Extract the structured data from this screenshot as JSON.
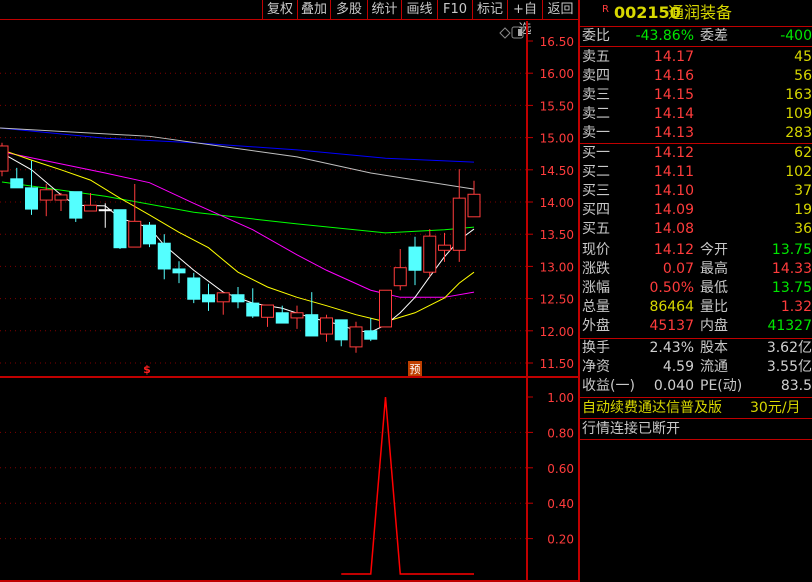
{
  "toolbar": {
    "buttons": [
      "复权",
      "叠加",
      "多股",
      "统计",
      "画线",
      "F10",
      "标记",
      "+自选",
      "返回"
    ]
  },
  "stock": {
    "flag": "R",
    "code": "002150",
    "name": "通润装备"
  },
  "committee": {
    "ratio_label": "委比",
    "ratio": "-43.86%",
    "diff_label": "委差",
    "diff": "-400"
  },
  "sell": [
    {
      "label": "卖五",
      "price": "14.17",
      "vol": "45"
    },
    {
      "label": "卖四",
      "price": "14.16",
      "vol": "56"
    },
    {
      "label": "卖三",
      "price": "14.15",
      "vol": "163"
    },
    {
      "label": "卖二",
      "price": "14.14",
      "vol": "109"
    },
    {
      "label": "卖一",
      "price": "14.13",
      "vol": "283"
    }
  ],
  "buy": [
    {
      "label": "买一",
      "price": "14.12",
      "vol": "62"
    },
    {
      "label": "买二",
      "price": "14.11",
      "vol": "102"
    },
    {
      "label": "买三",
      "price": "14.10",
      "vol": "37"
    },
    {
      "label": "买四",
      "price": "14.09",
      "vol": "19"
    },
    {
      "label": "买五",
      "price": "14.08",
      "vol": "36"
    }
  ],
  "quote": [
    {
      "l1": "现价",
      "v1": "14.12",
      "c1": "red",
      "l2": "今开",
      "v2": "13.75",
      "c2": "grn"
    },
    {
      "l1": "涨跌",
      "v1": "0.07",
      "c1": "red",
      "l2": "最高",
      "v2": "14.33",
      "c2": "red"
    },
    {
      "l1": "涨幅",
      "v1": "0.50%",
      "c1": "red",
      "l2": "最低",
      "v2": "13.75",
      "c2": "grn"
    },
    {
      "l1": "总量",
      "v1": "86464",
      "c1": "yel",
      "l2": "量比",
      "v2": "1.32",
      "c2": "red"
    },
    {
      "l1": "外盘",
      "v1": "45137",
      "c1": "red",
      "l2": "内盘",
      "v2": "41327",
      "c2": "grn"
    }
  ],
  "finance": [
    {
      "l1": "换手",
      "v1": "2.43%",
      "l2": "股本",
      "v2": "3.62亿"
    },
    {
      "l1": "净资",
      "v1": "4.59",
      "l2": "流通",
      "v2": "3.55亿"
    },
    {
      "l1": "收益(一)",
      "v1": "0.040",
      "l2": "PE(动)",
      "v2": "83.5"
    }
  ],
  "ad": {
    "text": "自动续费通达信普及版",
    "price": "30元/月"
  },
  "status": "行情连接已断开",
  "markers": {
    "s": "$",
    "yu": "预"
  },
  "colors": {
    "up": "#ff3c3c",
    "down": "#54ffff",
    "ma5": "#ffffff",
    "ma10": "#ffff00",
    "ma20": "#ff00ff",
    "ma30": "#00ff00",
    "ma60": "#c0c0c0",
    "ma120": "#0000ff",
    "grid": "#800000"
  },
  "chart_data": [
    {
      "type": "candlestick",
      "yticks": [
        "16.50",
        "16.00",
        "15.50",
        "15.00",
        "14.50",
        "14.00",
        "13.50",
        "13.00",
        "12.50",
        "12.00",
        "11.50"
      ],
      "ylim": [
        11.5,
        16.5
      ],
      "ohlc": [
        [
          14.48,
          14.92,
          14.4,
          14.87
        ],
        [
          14.36,
          14.53,
          14.22,
          14.22
        ],
        [
          14.22,
          14.64,
          13.8,
          13.89
        ],
        [
          14.03,
          14.28,
          13.78,
          14.19
        ],
        [
          14.03,
          14.14,
          13.86,
          14.11
        ],
        [
          14.16,
          14.16,
          13.69,
          13.75
        ],
        [
          13.86,
          14.14,
          13.86,
          13.95
        ],
        [
          13.88,
          13.98,
          13.6,
          13.88
        ],
        [
          13.88,
          13.88,
          13.27,
          13.29
        ],
        [
          13.3,
          14.28,
          13.3,
          13.7
        ],
        [
          13.64,
          13.69,
          13.3,
          13.35
        ],
        [
          13.36,
          13.5,
          12.8,
          12.96
        ],
        [
          12.96,
          13.08,
          12.74,
          12.9
        ],
        [
          12.82,
          12.9,
          12.43,
          12.49
        ],
        [
          12.56,
          12.73,
          12.31,
          12.45
        ],
        [
          12.45,
          12.59,
          12.25,
          12.59
        ],
        [
          12.56,
          12.68,
          12.35,
          12.45
        ],
        [
          12.43,
          12.66,
          12.2,
          12.23
        ],
        [
          12.21,
          12.39,
          12.06,
          12.4
        ],
        [
          12.28,
          12.39,
          12.12,
          12.12
        ],
        [
          12.2,
          12.39,
          12.03,
          12.28
        ],
        [
          12.25,
          12.6,
          11.92,
          11.92
        ],
        [
          11.95,
          12.25,
          11.83,
          12.2
        ],
        [
          12.17,
          12.17,
          11.76,
          11.86
        ],
        [
          11.75,
          12.14,
          11.66,
          12.06
        ],
        [
          12.0,
          12.2,
          11.84,
          11.87
        ],
        [
          12.06,
          12.63,
          12.06,
          12.63
        ],
        [
          12.7,
          13.27,
          12.63,
          12.98
        ],
        [
          13.3,
          13.46,
          12.71,
          12.94
        ],
        [
          12.91,
          13.58,
          12.84,
          13.47
        ],
        [
          13.25,
          13.52,
          13.07,
          13.33
        ],
        [
          13.25,
          14.51,
          13.07,
          14.06
        ],
        [
          13.77,
          14.33,
          13.77,
          14.12
        ]
      ],
      "ma": {
        "ma5": [
          [
            0,
            14.76
          ],
          [
            2,
            14.5
          ],
          [
            4,
            14.11
          ],
          [
            5,
            13.95
          ],
          [
            7,
            13.94
          ],
          [
            8,
            13.75
          ],
          [
            10,
            13.6
          ],
          [
            11,
            13.33
          ],
          [
            13,
            12.94
          ],
          [
            15,
            12.6
          ],
          [
            17,
            12.43
          ],
          [
            19,
            12.35
          ],
          [
            21,
            12.2
          ],
          [
            23,
            12.09
          ],
          [
            24,
            12.0
          ],
          [
            25,
            11.98
          ],
          [
            26,
            12.09
          ],
          [
            27,
            12.28
          ],
          [
            28,
            12.52
          ],
          [
            29,
            12.84
          ],
          [
            30,
            13.15
          ],
          [
            31,
            13.41
          ],
          [
            32,
            13.58
          ]
        ],
        "ma10": [
          [
            0,
            14.81
          ],
          [
            2,
            14.65
          ],
          [
            4,
            14.5
          ],
          [
            6,
            14.34
          ],
          [
            8,
            14.06
          ],
          [
            10,
            13.8
          ],
          [
            12,
            13.53
          ],
          [
            14,
            13.29
          ],
          [
            16,
            12.91
          ],
          [
            18,
            12.68
          ],
          [
            20,
            12.52
          ],
          [
            22,
            12.39
          ],
          [
            24,
            12.25
          ],
          [
            26,
            12.14
          ],
          [
            28,
            12.28
          ],
          [
            30,
            12.51
          ],
          [
            31,
            12.74
          ],
          [
            32,
            12.91
          ]
        ],
        "ma20": [
          [
            0,
            14.78
          ],
          [
            7,
            14.45
          ],
          [
            10,
            14.3
          ],
          [
            13,
            13.98
          ],
          [
            17,
            13.57
          ],
          [
            20,
            13.18
          ],
          [
            22,
            12.94
          ],
          [
            25,
            12.63
          ],
          [
            27,
            12.52
          ],
          [
            30,
            12.52
          ],
          [
            32,
            12.6
          ]
        ],
        "ma30": [
          [
            0,
            14.31
          ],
          [
            7,
            14.09
          ],
          [
            13,
            13.84
          ],
          [
            20,
            13.66
          ],
          [
            26,
            13.52
          ],
          [
            30,
            13.57
          ],
          [
            32,
            13.61
          ]
        ],
        "ma60": [
          [
            -0.2,
            15.15
          ],
          [
            10,
            15.02
          ],
          [
            20,
            14.7
          ],
          [
            25,
            14.45
          ],
          [
            32,
            14.2
          ]
        ],
        "ma120": [
          [
            -0.2,
            15.15
          ],
          [
            7,
            14.99
          ],
          [
            13,
            14.92
          ],
          [
            20,
            14.81
          ],
          [
            26,
            14.68
          ],
          [
            32,
            14.62
          ]
        ]
      }
    },
    {
      "type": "line",
      "yticks": [
        "1.00",
        "0.80",
        "0.60",
        "0.40",
        "0.20"
      ],
      "ylim": [
        0,
        1.05
      ],
      "points": [
        [
          23,
          0
        ],
        [
          25,
          0
        ],
        [
          26,
          1
        ],
        [
          27,
          0
        ],
        [
          32,
          0
        ]
      ]
    }
  ]
}
